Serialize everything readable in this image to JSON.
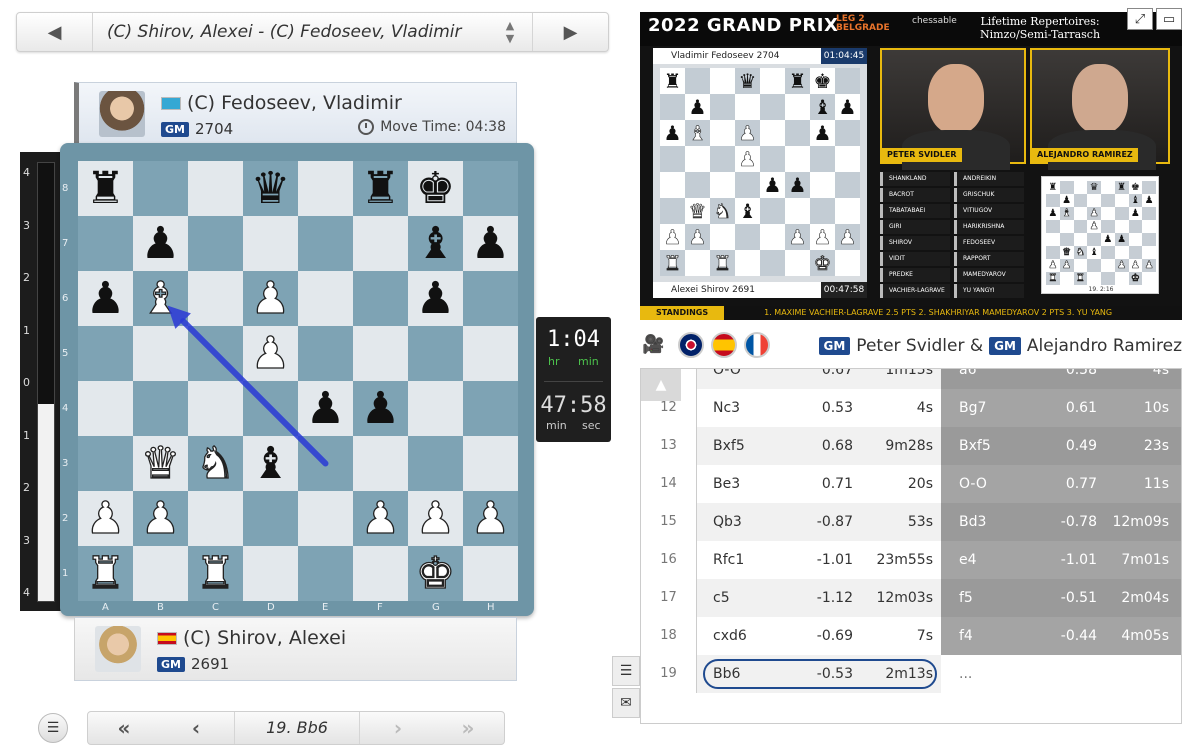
{
  "topnav": {
    "prev": "◀",
    "next": "▶",
    "game_title": "(C) Shirov, Alexei - (C) Fedoseev, Vladimir",
    "sort_up": "▲",
    "sort_down": "▼"
  },
  "top_player": {
    "name": "(C) Fedoseev, Vladimir",
    "title": "GM",
    "rating": "2704",
    "move_time_label": "Move Time: 04:38"
  },
  "bottom_player": {
    "name": "(C) Shirov, Alexei",
    "title": "GM",
    "rating": "2691"
  },
  "eval_bar": {
    "white_share": 0.45,
    "ticks": [
      "4",
      "3",
      "2",
      "1",
      "0",
      "1",
      "2",
      "3",
      "4"
    ]
  },
  "board": {
    "files": [
      "A",
      "B",
      "C",
      "D",
      "E",
      "F",
      "G",
      "H"
    ],
    "ranks": [
      "8",
      "7",
      "6",
      "5",
      "4",
      "3",
      "2",
      "1"
    ],
    "position": [
      [
        "bR",
        "",
        "",
        "bQ",
        "",
        "bR",
        "bK",
        ""
      ],
      [
        "",
        "bP",
        "",
        "",
        "",
        "",
        "bB",
        "bP"
      ],
      [
        "bP",
        "wB",
        "",
        "wP",
        "",
        "",
        "bP",
        ""
      ],
      [
        "",
        "",
        "",
        "wP",
        "",
        "",
        "",
        ""
      ],
      [
        "",
        "",
        "",
        "",
        "bP",
        "bP",
        "",
        ""
      ],
      [
        "",
        "wQ",
        "wN",
        "bB",
        "",
        "",
        "",
        ""
      ],
      [
        "wP",
        "wP",
        "",
        "",
        "",
        "wP",
        "wP",
        "wP"
      ],
      [
        "wR",
        "",
        "wR",
        "",
        "",
        "",
        "wK",
        ""
      ]
    ],
    "arrow_color": "#2a3ad6",
    "arrow_from": "e3",
    "arrow_to": "b6"
  },
  "clock": {
    "top_value": "1:04",
    "top_unit_hr": "hr",
    "top_unit_min": "min",
    "bottom_value": "47:58",
    "bottom_unit_min": "min",
    "bottom_unit_sec": "sec"
  },
  "bottom_nav": {
    "menu": "☰",
    "first": "«",
    "prev": "‹",
    "current": "19. Bb6",
    "next": "›",
    "last": "»"
  },
  "video": {
    "title": "2022 GRAND PRIX",
    "leg_line1": "LEG 2",
    "leg_line2": "BELGRADE",
    "sponsor": "chessable",
    "repertoire_line1": "Lifetime Repertoires:",
    "repertoire_line2": "Nimzo/Semi-Tarrasch",
    "board_top_player": "Vladimir Fedoseev 2704",
    "board_top_time": "01:04:45",
    "board_bottom_player": "Alexei Shirov 2691",
    "board_bottom_time": "00:47:58",
    "cam1_label": "PETER SVIDLER",
    "cam2_label": "ALEJANDRO RAMIREZ",
    "pairings": [
      [
        "SHANKLAND",
        "ANDREIKIN"
      ],
      [
        "BACROT",
        "GRISCHUK"
      ],
      [
        "TABATABAEI",
        "VITIUGOV"
      ],
      [
        "GIRI",
        "HARIKRISHNA"
      ],
      [
        "SHIROV",
        "FEDOSEEV"
      ],
      [
        "VIDIT",
        "RAPPORT"
      ],
      [
        "PREDKE",
        "MAMEDYAROV"
      ],
      [
        "VACHIER-LAGRAVE",
        "YU YANGYI"
      ]
    ],
    "ticker_label": "STANDINGS",
    "ticker_text": "1. MAXIME VACHIER-LAGRAVE  2.5 PTS        2. SHAKHRIYAR MAMEDYAROV  2 PTS        3. YU YANG",
    "mini_caption": "19. 2:16"
  },
  "video_controls": {
    "restore": "⤢",
    "window": "▭"
  },
  "commentators": {
    "title1": "GM",
    "name1": "Peter Svidler &",
    "title2": "GM",
    "name2": "Alejandro Ramirez"
  },
  "moves": [
    {
      "n": "11",
      "w": "O-O",
      "we": "0.67",
      "wt": "1m15s",
      "b": "a6",
      "be": "0.58",
      "bt": "4s"
    },
    {
      "n": "12",
      "w": "Nc3",
      "we": "0.53",
      "wt": "4s",
      "b": "Bg7",
      "be": "0.61",
      "bt": "10s"
    },
    {
      "n": "13",
      "w": "Bxf5",
      "we": "0.68",
      "wt": "9m28s",
      "b": "Bxf5",
      "be": "0.49",
      "bt": "23s"
    },
    {
      "n": "14",
      "w": "Be3",
      "we": "0.71",
      "wt": "20s",
      "b": "O-O",
      "be": "0.77",
      "bt": "11s"
    },
    {
      "n": "15",
      "w": "Qb3",
      "we": "-0.87",
      "wt": "53s",
      "b": "Bd3",
      "be": "-0.78",
      "bt": "12m09s"
    },
    {
      "n": "16",
      "w": "Rfc1",
      "we": "-1.01",
      "wt": "23m55s",
      "b": "e4",
      "be": "-1.01",
      "bt": "7m01s"
    },
    {
      "n": "17",
      "w": "c5",
      "we": "-1.12",
      "wt": "12m03s",
      "b": "f5",
      "be": "-0.51",
      "bt": "2m04s"
    },
    {
      "n": "18",
      "w": "cxd6",
      "we": "-0.69",
      "wt": "7s",
      "b": "f4",
      "be": "-0.44",
      "bt": "4m05s"
    },
    {
      "n": "19",
      "w": "Bb6",
      "we": "-0.53",
      "wt": "2m13s",
      "b": "...",
      "be": "",
      "bt": ""
    }
  ],
  "table_up": "▲"
}
